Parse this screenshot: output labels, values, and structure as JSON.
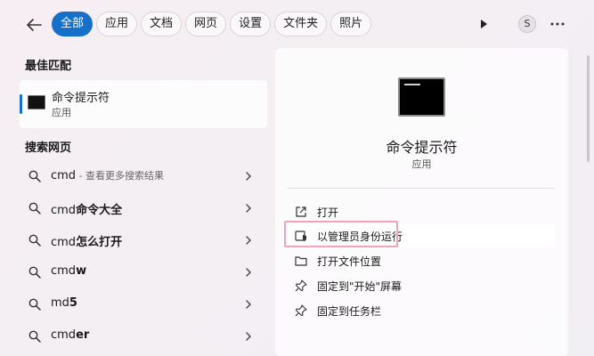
{
  "tabs": [
    {
      "label": "全部",
      "active": true
    },
    {
      "label": "应用",
      "active": false
    },
    {
      "label": "文档",
      "active": false
    },
    {
      "label": "网页",
      "active": false
    },
    {
      "label": "设置",
      "active": false
    },
    {
      "label": "文件夹",
      "active": false
    },
    {
      "label": "照片",
      "active": false
    }
  ],
  "user": {
    "initial": "S"
  },
  "best_match": {
    "heading": "最佳匹配",
    "title": "命令提示符",
    "subtitle": "应用"
  },
  "web_search": {
    "heading": "搜索网页",
    "results": [
      {
        "bold": "",
        "text": "cmd",
        "hint": " - 查看更多搜索结果"
      },
      {
        "bold": "命令大全",
        "text": "cmd",
        "hint": ""
      },
      {
        "bold": "怎么打开",
        "text": "cmd",
        "hint": ""
      },
      {
        "bold": "w",
        "text": "cmd",
        "hint": ""
      },
      {
        "bold": "5",
        "text": "md",
        "hint": ""
      },
      {
        "bold": "er",
        "text": "cmd",
        "hint": ""
      }
    ]
  },
  "detail": {
    "title": "命令提示符",
    "subtitle": "应用",
    "actions": [
      {
        "label": "打开",
        "icon": "open-external-icon"
      },
      {
        "label": "以管理员身份运行",
        "icon": "shield-admin-icon"
      },
      {
        "label": "打开文件位置",
        "icon": "folder-icon"
      },
      {
        "label": "固定到\"开始\"屏幕",
        "icon": "pin-icon"
      },
      {
        "label": "固定到任务栏",
        "icon": "pin-icon"
      }
    ]
  },
  "colors": {
    "accent": "#1670c9",
    "highlight_border": "#f2a3b8"
  }
}
